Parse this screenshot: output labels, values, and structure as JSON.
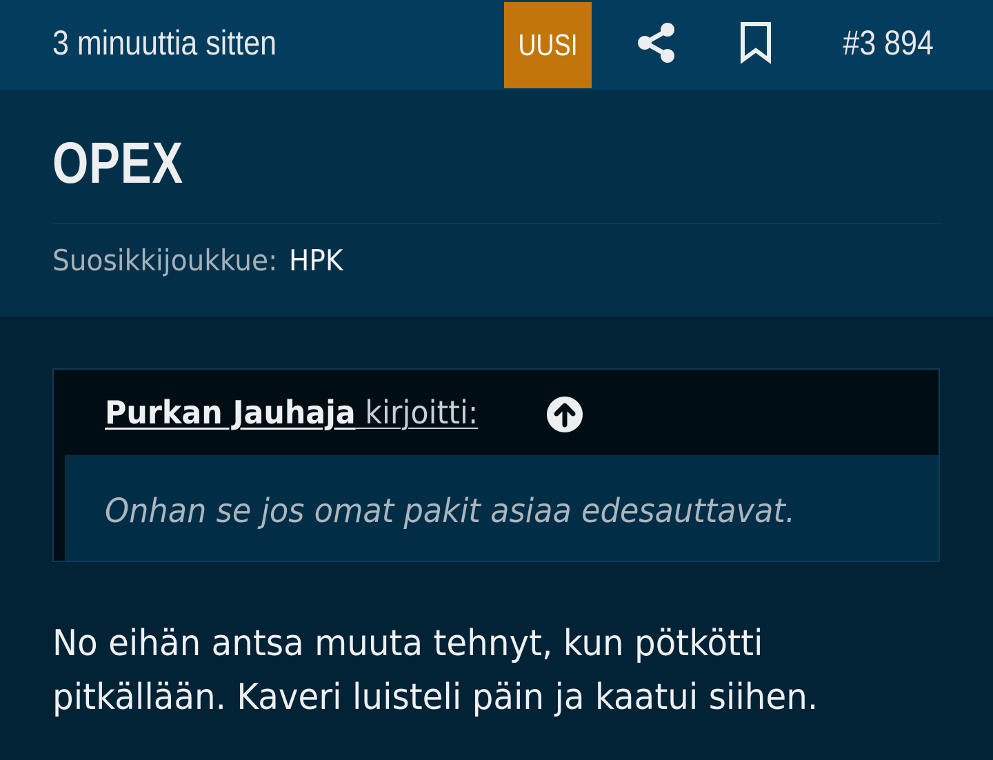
{
  "post_header": {
    "timestamp": "3 minuuttia sitten",
    "new_badge": "UUSI",
    "share_icon": "share-icon",
    "bookmark_icon": "bookmark-icon",
    "post_number": "#3 894"
  },
  "author": {
    "name": "OPEX",
    "favorite_team_label": "Suosikkijoukkue:",
    "favorite_team": "HPK"
  },
  "quote": {
    "author": "Purkan Jauhaja",
    "wrote_label": " kirjoitti:",
    "jump_icon": "arrow-up-circle-icon",
    "text": "Onhan se jos omat pakit asiaa edesauttavat."
  },
  "body": {
    "lines": [
      "No eihän antsa muuta tehnyt, kun pötkötti",
      "pitkällään. Kaveri luisteli päin ja kaatui siihen."
    ]
  },
  "colors": {
    "badge": "#c1750a",
    "topbar": "#033c5c",
    "page_background": "#022236"
  }
}
